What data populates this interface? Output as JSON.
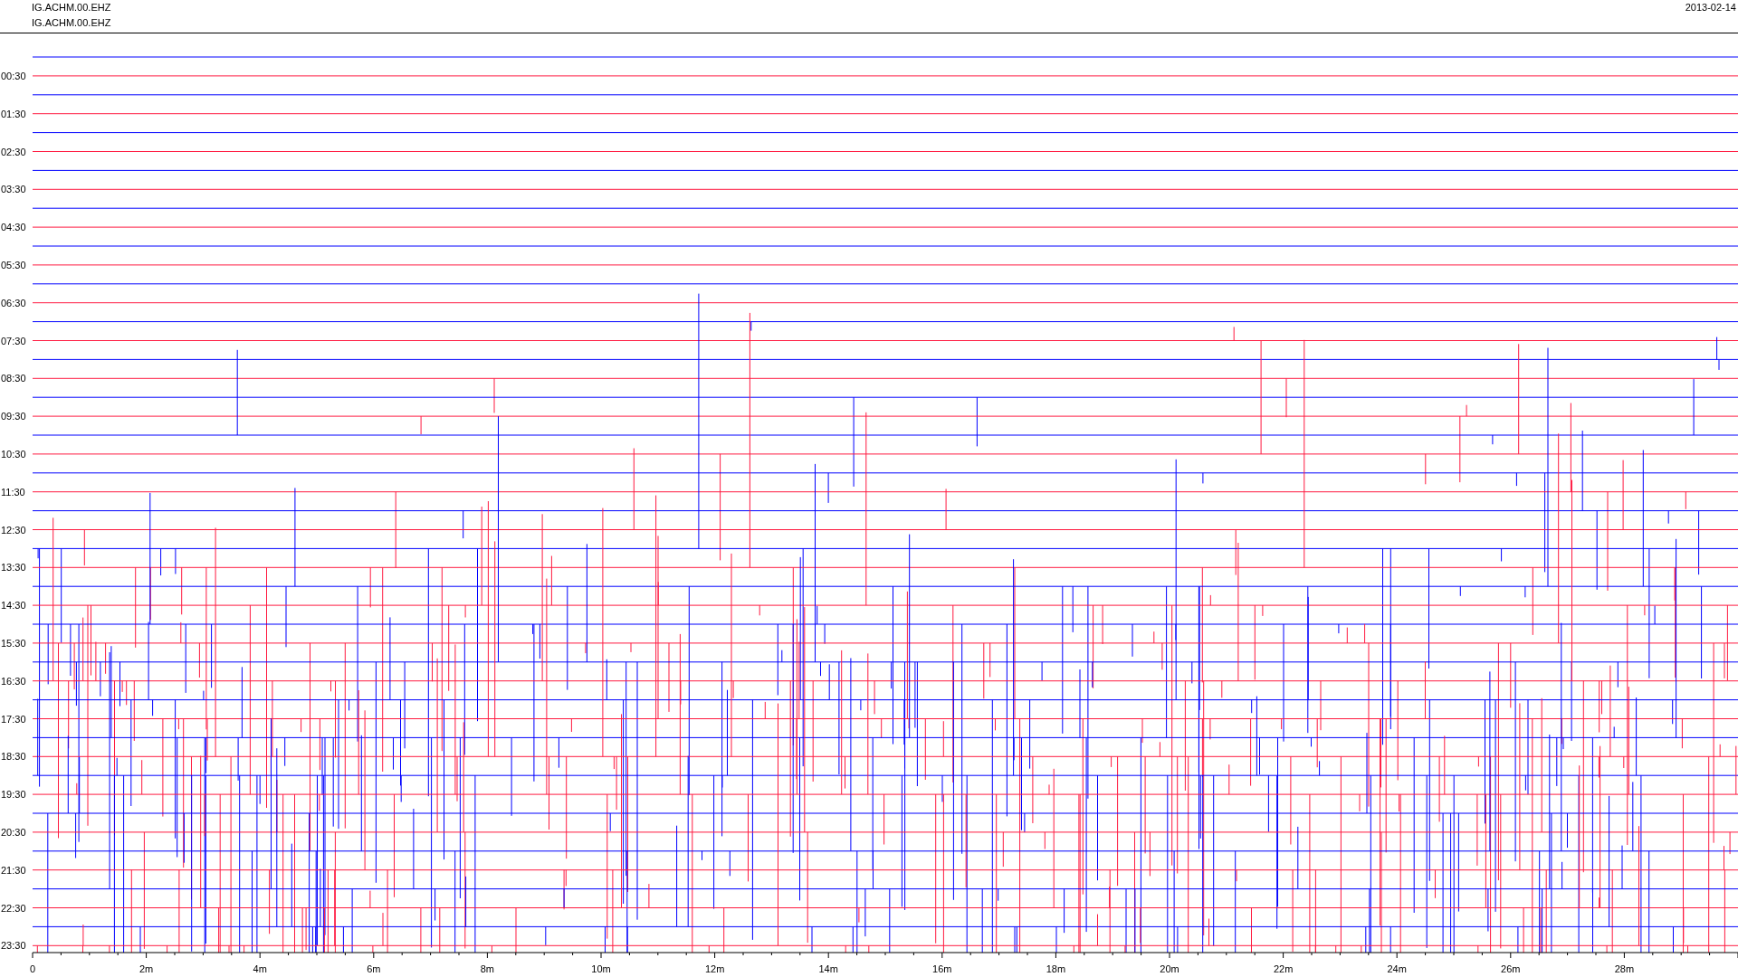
{
  "header": {
    "station_lines": [
      "IG.ACHM.00.EHZ",
      "IG.ACHM.00.EHZ"
    ],
    "date": "2013-02-14"
  },
  "plot": {
    "hour_labels": [
      "00:30",
      "01:30",
      "02:30",
      "03:30",
      "04:30",
      "05:30",
      "06:30",
      "07:30",
      "08:30",
      "09:30",
      "10:30",
      "11:30",
      "12:30",
      "13:30",
      "14:30",
      "15:30",
      "16:30",
      "17:30",
      "18:30",
      "19:30",
      "20:30",
      "21:30",
      "22:30",
      "23:30"
    ],
    "minute_labels": [
      "0",
      "2m",
      "4m",
      "6m",
      "8m",
      "10m",
      "12m",
      "14m",
      "16m",
      "18m",
      "20m",
      "22m",
      "24m",
      "26m",
      "28m"
    ]
  }
}
